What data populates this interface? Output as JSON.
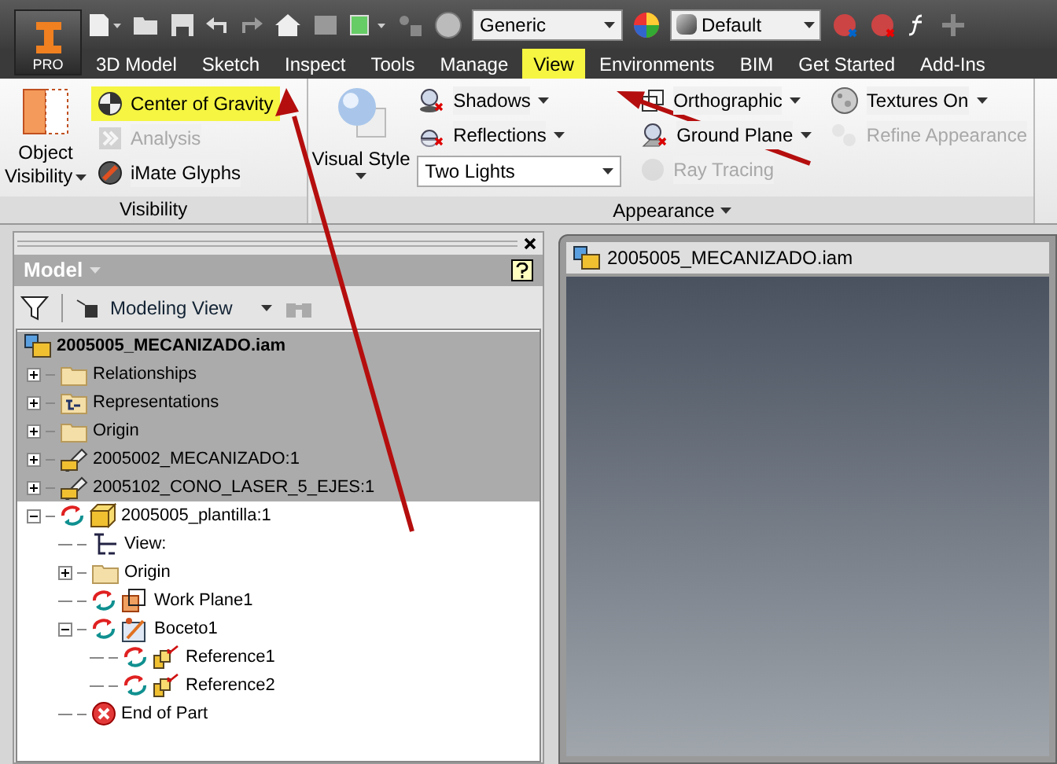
{
  "app_button": {
    "label": "PRO"
  },
  "quick_access": {
    "material": "Generic",
    "appearance": "Default"
  },
  "ribbon_tabs": [
    {
      "label": "3D Model",
      "selected": false
    },
    {
      "label": "Sketch",
      "selected": false
    },
    {
      "label": "Inspect",
      "selected": false
    },
    {
      "label": "Tools",
      "selected": false
    },
    {
      "label": "Manage",
      "selected": false
    },
    {
      "label": "View",
      "selected": true,
      "highlighted": true
    },
    {
      "label": "Environments",
      "selected": false
    },
    {
      "label": "BIM",
      "selected": false
    },
    {
      "label": "Get Started",
      "selected": false
    },
    {
      "label": "Add-Ins",
      "selected": false
    }
  ],
  "visibility_panel": {
    "title": "Visibility",
    "object_visibility": [
      "Object",
      "Visibility"
    ],
    "items": [
      {
        "kind": "cog",
        "label": "Center of Gravity",
        "disabled": false,
        "highlighted": true
      },
      {
        "kind": "analysis",
        "label": "Analysis",
        "disabled": true,
        "highlighted": false
      },
      {
        "kind": "imate",
        "label": "iMate Glyphs",
        "disabled": false,
        "highlighted": false
      }
    ]
  },
  "appearance_panel": {
    "title": "Appearance",
    "visual_style": "Visual Style",
    "lighting": "Two Lights",
    "column_1": [
      {
        "kind": "shadows",
        "label": "Shadows",
        "disabled": false
      },
      {
        "kind": "reflections",
        "label": "Reflections",
        "disabled": false
      }
    ],
    "column_2": [
      {
        "kind": "orthographic",
        "label": "Orthographic",
        "disabled": false
      },
      {
        "kind": "ground",
        "label": "Ground Plane",
        "disabled": false
      },
      {
        "kind": "raytrace",
        "label": "Ray Tracing",
        "disabled": true
      }
    ],
    "column_3": [
      {
        "kind": "textures",
        "label": "Textures On",
        "disabled": false
      },
      {
        "kind": "refine",
        "label": "Refine Appearance",
        "disabled": true
      }
    ]
  },
  "browser": {
    "title": "Model",
    "view": "Modeling View",
    "tree": [
      {
        "label": "2005005_MECANIZADO.iam",
        "kind": "assembly",
        "shaded": true,
        "update": false,
        "children": [
          {
            "label": "Relationships",
            "kind": "folder",
            "shaded": true,
            "update": false,
            "expanded": false
          },
          {
            "label": "Representations",
            "kind": "representations",
            "shaded": true,
            "update": false,
            "expanded": false
          },
          {
            "label": "Origin",
            "kind": "folder",
            "shaded": true,
            "update": false,
            "expanded": false
          },
          {
            "label": "2005002_MECANIZADO:1",
            "kind": "component",
            "shaded": true,
            "update": false,
            "expanded": false
          },
          {
            "label": "2005102_CONO_LASER_5_EJES:1",
            "kind": "component",
            "shaded": true,
            "update": false,
            "expanded": false
          },
          {
            "label": "2005005_plantilla:1",
            "kind": "part",
            "shaded": false,
            "update": true,
            "expanded": true,
            "children": [
              {
                "label": "View:",
                "kind": "view",
                "shaded": false,
                "update": false
              },
              {
                "label": "Origin",
                "kind": "folder",
                "shaded": false,
                "update": false,
                "expanded": false
              },
              {
                "label": "Work Plane1",
                "kind": "workplane",
                "shaded": false,
                "update": true
              },
              {
                "label": "Boceto1",
                "kind": "sketch",
                "shaded": false,
                "update": true,
                "expanded": true,
                "children": [
                  {
                    "label": "Reference1",
                    "kind": "reference",
                    "shaded": false,
                    "update": true
                  },
                  {
                    "label": "Reference2",
                    "kind": "reference",
                    "shaded": false,
                    "update": true
                  }
                ]
              },
              {
                "label": "End of Part",
                "kind": "end",
                "shaded": false,
                "update": false
              }
            ]
          }
        ]
      }
    ]
  },
  "viewport": {
    "document": "2005005_MECANIZADO.iam"
  }
}
